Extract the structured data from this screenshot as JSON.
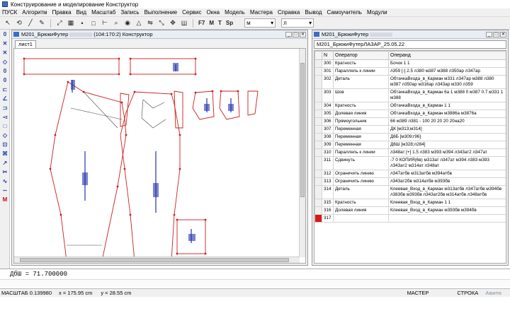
{
  "window": {
    "title": "Конструирование и моделирование  Конструктор"
  },
  "menu": [
    "ПУСК",
    "Алгоритм",
    "Правка",
    "Вид",
    "Масштаб",
    "Запись",
    "Выполнение",
    "Сервис",
    "Окна",
    "Модель",
    "Мастера",
    "Справка",
    "Вывод",
    "Самоучитель",
    "Модули"
  ],
  "toolbar": {
    "icons": [
      "pointer-icon",
      "rotate-icon",
      "line-icon",
      "pen-icon",
      "transform-icon",
      "grid-icon",
      "dot-icon",
      "square-icon",
      "ruler-icon",
      "zoom-icon",
      "eye-icon",
      "triangle-icon",
      "mirror-icon",
      "scale-icon",
      "move-icon",
      "bold-text-icon"
    ],
    "f7_label": "F7",
    "m_label": "M",
    "t_label": "T",
    "sp_label": "Sp",
    "select1_value": "м",
    "select2_value": "л"
  },
  "left_tools": [
    "0",
    "✕",
    "✕",
    "◇",
    "0",
    "0",
    "⊏",
    "∠",
    "⊐",
    "◅",
    "□",
    "◇",
    "⊡",
    "⌘",
    "↗",
    "✂",
    "∿",
    "∽",
    "M"
  ],
  "drawing_window": {
    "title_prefix": "М201_БрюкиФутер",
    "title_suffix": "(104:170:2) Конструктор",
    "tab_label": "лист1"
  },
  "table_window": {
    "title": "М201_БрюкиФутер",
    "subtitle": "М201_БрюкиФутерЛАЗАР_25.05.22",
    "columns": [
      "N",
      "Оператор",
      "Операнд"
    ],
    "rows": [
      {
        "n": "300",
        "op": "Кратность",
        "arg": "Бочок 1 1"
      },
      {
        "n": "301",
        "op": "Параллель к линии",
        "arg": "л359 [-] 2.5 л380 м387 м388 л350ар л347ар"
      },
      {
        "n": "302",
        "op": "Деталь",
        "arg": "ОбтачкаВхода_в_Карман м331 л347ар м388 л380 м387 л350ар м316ар л343ар м330 л359"
      },
      {
        "n": "303",
        "op": "Шов",
        "arg": "ОбтачкаВхода_в_Карман 6а 1 м388 0 м387 0.7 м331 1 м388"
      },
      {
        "n": "304",
        "op": "Кратность",
        "arg": "ОбтачкаВхода_в_Карман 1 1"
      },
      {
        "n": "305",
        "op": "Долевая линия",
        "arg": "ОбтачкаВхода_в_Карман м3886а м3876а"
      },
      {
        "n": "306",
        "op": "Прямоугольник",
        "arg": "66 м389 л381 - 100 20 20 20 20на20"
      },
      {
        "n": "307",
        "op": "Переменная",
        "arg": "ДК [м313;м314]"
      },
      {
        "n": "308",
        "op": "Переменная",
        "arg": "Д6Б [м309;г96]"
      },
      {
        "n": "309",
        "op": "Переменная",
        "arg": "Д6Ш [м328;л284]"
      },
      {
        "n": "310",
        "op": "Параллель к линии",
        "arg": "л348ат [+] 1.5 л383 м393 м394 л343ат2 л347ат"
      },
      {
        "n": "311",
        "op": "Сдвинуть",
        "arg": "-7 0 КОПИЯ(6в) м313ат л347ат м394 л383 м393 л343ат2 м314ат л348ат"
      },
      {
        "n": "312",
        "op": "Ограничить линию",
        "arg": "л347атбв м313атбв м394атбв"
      },
      {
        "n": "313",
        "op": "Ограничить линию",
        "arg": "л343ат2бв м314атбв м393бв"
      },
      {
        "n": "314",
        "op": "Деталь",
        "arg": "Клеевая_Вход_в_Карман м313атбв л347атбв м394бв л383бв м393бв л343ат2бв м314атбв л348атбв"
      },
      {
        "n": "315",
        "op": "Кратность",
        "arg": "Клеевая_Вход_в_Карман 1 1"
      },
      {
        "n": "316",
        "op": "Долевая линия",
        "arg": "Клеевая_Вход_в_Карман м393бв м394бв"
      },
      {
        "n": "317",
        "op": "",
        "arg": ""
      }
    ]
  },
  "command_line": "ДбШ = 71.700000",
  "status": {
    "scale": "МАСШТАБ 0.139980",
    "x": "x = 175.95 cm",
    "y": "y = 28.55 cm",
    "master": "МАСТЕР",
    "line_mode": "СТРОКА",
    "watermark": "Авито"
  },
  "colors": {
    "pattern_outline": "#c8201c",
    "pattern_inner": "#444444",
    "grain_marks": "#2030b0",
    "point_dots": "#d01818",
    "selected_row_marker": "#d81818"
  }
}
